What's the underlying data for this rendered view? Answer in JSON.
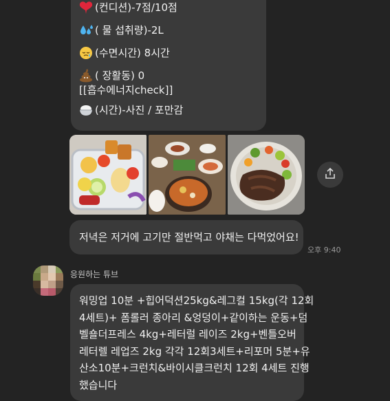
{
  "top_message": {
    "lines": [
      {
        "icon": "heart-icon",
        "text": "(컨디션)-7점/10점"
      },
      {
        "icon": "water-drops-icon",
        "text": "( 물 섭취량)-2L"
      },
      {
        "icon": "sleepy-face-icon",
        "text": "(수면시간) 8시간"
      },
      {
        "icon": "poop-icon",
        "text": "( 장활동) 0"
      },
      {
        "icon": "",
        "text": "[[흡수에너지check]]"
      },
      {
        "icon": "rice-bowl-icon",
        "text": "(시간)-사진 / 포만감"
      }
    ]
  },
  "photos": [
    "meal-photo-lunchbox",
    "meal-photo-restaurant",
    "meal-photo-meat-salad"
  ],
  "dinner_message": {
    "text": "저녁은 저거에 고기만 절반먹고 야채는 다먹었어요!",
    "time": "오후 9:40"
  },
  "incoming": {
    "sender": "응원하는 튜브",
    "text": "워밍업 10분 +힙어덕션25kg&레그컬 15kg(각 12회\n4세트)+ 폼롤러 종아리 &엉덩이+같이하는 운동+덤\n벨숄더프레스 4kg+레터럴 레이즈 2kg+벤틀오버\n레터렐 레업즈 2kg 각각 12회3세트+리포머 5분+유\n산소10분+크런치&바이시클크런치 12회 4세트 진행\n했습니다"
  },
  "colors": {
    "background": "#232323",
    "bubble": "#3a3a3a",
    "text": "#f2f2f2",
    "meta_text": "#9a9a9a"
  }
}
